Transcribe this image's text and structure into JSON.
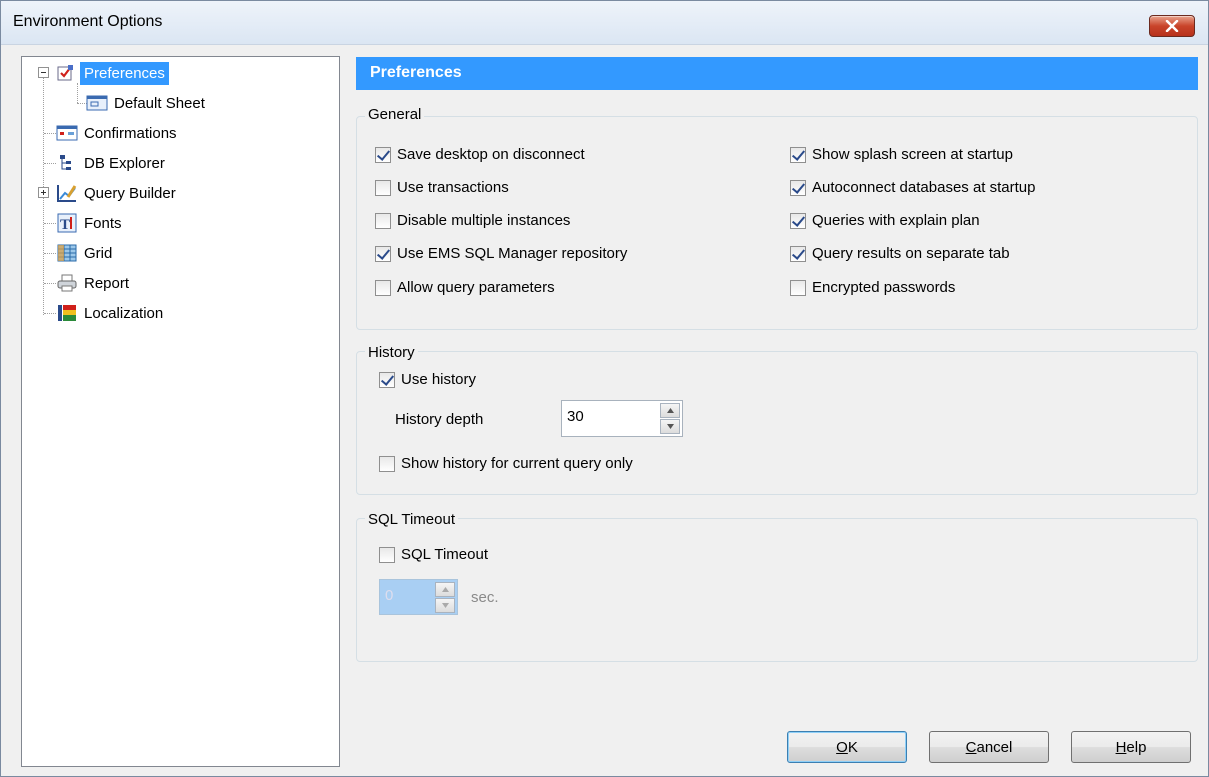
{
  "window": {
    "title": "Environment Options"
  },
  "tree": {
    "items": [
      {
        "label": "Preferences",
        "icon": "checkbox-icon",
        "selected": true
      },
      {
        "label": "Default Sheet",
        "icon": "sheet-icon"
      },
      {
        "label": "Confirmations",
        "icon": "confirm-window-icon"
      },
      {
        "label": "DB Explorer",
        "icon": "tree-structure-icon"
      },
      {
        "label": "Query Builder",
        "icon": "chart-pencil-icon"
      },
      {
        "label": "Fonts",
        "icon": "font-icon"
      },
      {
        "label": "Grid",
        "icon": "grid-icon"
      },
      {
        "label": "Report",
        "icon": "printer-icon"
      },
      {
        "label": "Localization",
        "icon": "flags-icon"
      }
    ]
  },
  "header": {
    "title": "Preferences"
  },
  "general": {
    "title": "General",
    "left": [
      {
        "label": "Save desktop on disconnect",
        "checked": true
      },
      {
        "label": "Use transactions",
        "checked": false
      },
      {
        "label": "Disable multiple instances",
        "checked": false
      },
      {
        "label": "Use EMS SQL Manager repository",
        "checked": true
      },
      {
        "label": "Allow query parameters",
        "checked": false
      }
    ],
    "right": [
      {
        "label": "Show splash screen at startup",
        "checked": true
      },
      {
        "label": "Autoconnect databases at startup",
        "checked": true
      },
      {
        "label": "Queries with explain plan",
        "checked": true
      },
      {
        "label": "Query results on separate tab",
        "checked": true
      },
      {
        "label": "Encrypted passwords",
        "checked": false
      }
    ]
  },
  "history": {
    "title": "History",
    "use_history": "Use history",
    "use_history_checked": true,
    "depth_label": "History depth",
    "depth_value": "30",
    "current_only": "Show history for current query only",
    "current_only_checked": false
  },
  "timeout": {
    "title": "SQL Timeout",
    "checkbox": "SQL Timeout",
    "checked": false,
    "value": "0",
    "unit": "sec."
  },
  "buttons": {
    "ok_accel": "O",
    "ok_rest": "K",
    "cancel_accel": "C",
    "cancel_rest": "ancel",
    "help_accel": "H",
    "help_rest": "elp"
  }
}
